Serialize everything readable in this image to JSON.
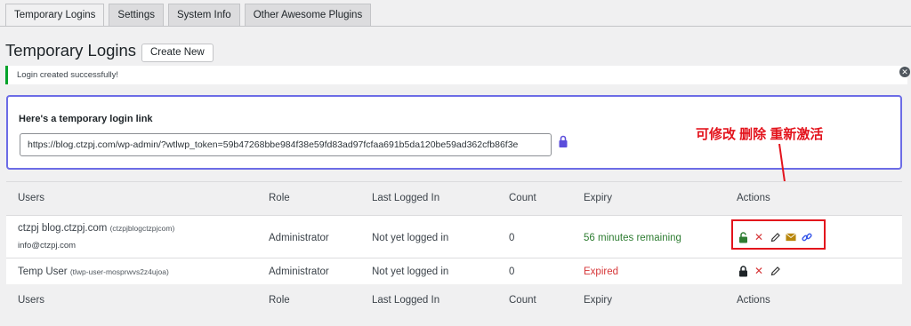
{
  "tabs": [
    {
      "label": "Temporary Logins",
      "active": true
    },
    {
      "label": "Settings",
      "active": false
    },
    {
      "label": "System Info",
      "active": false
    },
    {
      "label": "Other Awesome Plugins",
      "active": false
    }
  ],
  "page": {
    "title": "Temporary Logins",
    "create_button": "Create New"
  },
  "notice": {
    "text": "Login created successfully!",
    "color": "#00a32a"
  },
  "link_box": {
    "label": "Here's a temporary login link",
    "url": "https://blog.ctzpj.com/wp-admin/?wtlwp_token=59b47268bbe984f38e59fd83ad97fcfaa691b5da120be59ad362cfb86f3e"
  },
  "annotation": {
    "text": "可修改 删除 重新激活",
    "color": "#e3131c"
  },
  "table": {
    "headers": [
      "Users",
      "Role",
      "Last Logged In",
      "Count",
      "Expiry",
      "Actions"
    ],
    "rows": [
      {
        "name": "ctzpj blog.ctzpj.com",
        "username": "(ctzpjblogctzpjcom)",
        "email": "info@ctzpj.com",
        "role": "Administrator",
        "last_login": "Not yet logged in",
        "count": "0",
        "expiry": "56 minutes remaining",
        "expiry_color": "#2e7d32",
        "actions": [
          "unlock-icon",
          "delete-icon",
          "edit-icon",
          "email-icon",
          "link-icon"
        ]
      },
      {
        "name": "Temp User",
        "username": "(tlwp-user-mosprwvs2z4ujoa)",
        "email": "",
        "role": "Administrator",
        "last_login": "Not yet logged in",
        "count": "0",
        "expiry": "Expired",
        "expiry_color": "#d63638",
        "actions": [
          "lock-icon",
          "delete-icon",
          "edit-icon"
        ]
      }
    ]
  }
}
